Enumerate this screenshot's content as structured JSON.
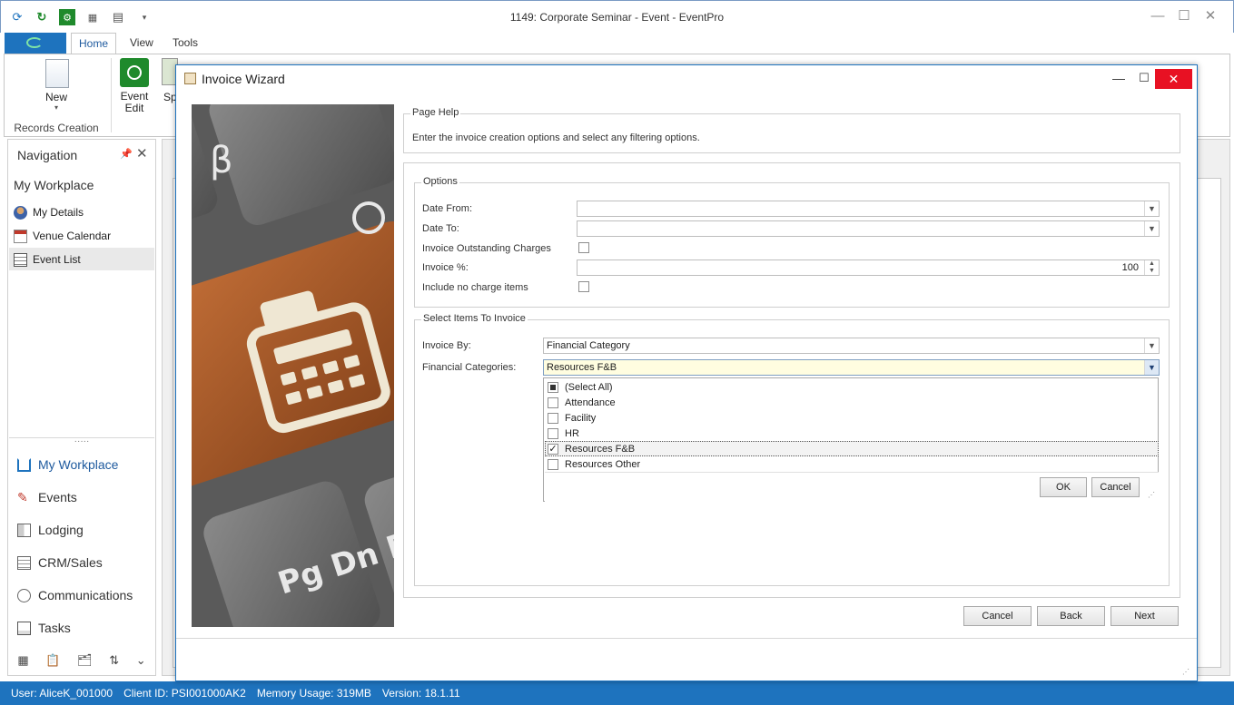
{
  "app": {
    "title": "1149: Corporate Seminar - Event - EventPro",
    "window_controls": {
      "minimize": "—",
      "maximize": "☐",
      "close": "✕"
    },
    "qa_icons": [
      "refresh-icon",
      "reload-green-icon",
      "settings-green-icon",
      "calendar-icon",
      "clipboard-icon",
      "qa-dropdown-icon"
    ]
  },
  "ribbon": {
    "tabs": {
      "home": "Home",
      "view": "View",
      "tools": "Tools"
    },
    "new_label": "New",
    "new_arrow": "▾",
    "group_label": "Records Creation",
    "event_edit_label1": "Event",
    "event_edit_label2": "Edit",
    "sp_label": "Sp"
  },
  "navigation": {
    "title": "Navigation",
    "pin": "📌",
    "close": "✕",
    "workplace_title": "My Workplace",
    "links": [
      "My Details",
      "Venue Calendar",
      "Event List"
    ],
    "splitter": "·····",
    "big_items": [
      "My Workplace",
      "Events",
      "Lodging",
      "CRM/Sales",
      "Communications",
      "Tasks"
    ],
    "bottom_icons": [
      "▦",
      "📋",
      "🗂",
      "⇅",
      "⌄"
    ]
  },
  "status": {
    "user": "User: AliceK_001000",
    "client": "Client ID: PSI001000AK2",
    "memory": "Memory Usage: 319MB",
    "version": "Version: 18.1.11"
  },
  "wizard": {
    "title": "Invoice Wizard",
    "min": "—",
    "max": "☐",
    "close": "✕",
    "page_help": {
      "title": "Page Help",
      "text": "Enter the invoice creation options and select any filtering options."
    },
    "options": {
      "title": "Options",
      "date_from_label": "Date From:",
      "date_from_value": "",
      "date_to_label": "Date To:",
      "date_to_value": "",
      "outstanding_label": "Invoice Outstanding Charges",
      "invoice_pct_label": "Invoice %:",
      "invoice_pct_value": "100",
      "no_charge_label": "Include no charge items"
    },
    "select_items": {
      "title": "Select Items To Invoice",
      "invoice_by_label": "Invoice By:",
      "invoice_by_value": "Financial Category",
      "fin_cat_label": "Financial Categories:",
      "fin_cat_value": "Resources F&B",
      "dropdown_items": [
        {
          "label": "(Select All)",
          "state": "partial"
        },
        {
          "label": "Attendance",
          "state": "unchecked"
        },
        {
          "label": "Facility",
          "state": "unchecked"
        },
        {
          "label": "HR",
          "state": "unchecked"
        },
        {
          "label": "Resources F&B",
          "state": "checked"
        },
        {
          "label": "Resources Other",
          "state": "unchecked"
        }
      ],
      "ok_label": "OK",
      "cancel_label": "Cancel"
    },
    "buttons": {
      "cancel": "Cancel",
      "back": "Back",
      "next": "Next"
    },
    "image_keys": {
      "beta": "β",
      "pgdn": "Pg Dn E"
    }
  },
  "colors": {
    "accent": "#1e73be",
    "close_red": "#e81123",
    "green": "#1f8a2c",
    "highlight_yellow": "#fffde0"
  }
}
